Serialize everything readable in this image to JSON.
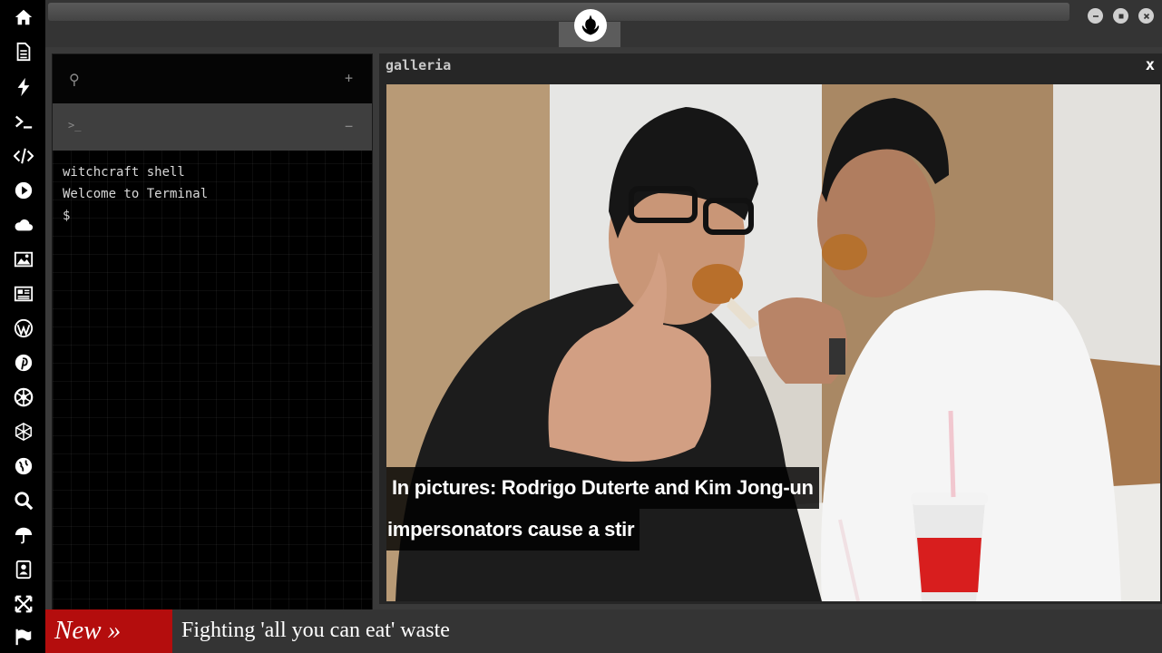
{
  "rail": {
    "icons": [
      "home-icon",
      "document-icon",
      "bolt-icon",
      "terminal-icon",
      "code-icon",
      "play-icon",
      "cloud-icon",
      "image-icon",
      "newspaper-icon",
      "wordpress-icon",
      "pinterest-icon",
      "rebel-badge-icon",
      "hexagon-network-icon",
      "globe-icon",
      "search-icon",
      "umbrella-icon",
      "contacts-icon",
      "expand-icon",
      "flag-icon"
    ]
  },
  "terminal": {
    "search_glyph": "⚲",
    "add_glyph": "+",
    "tab_prompt_glyph": ">_",
    "tab_close_glyph": "−",
    "lines": [
      "witchcraft shell",
      "Welcome to Terminal",
      "$"
    ]
  },
  "galleria": {
    "title": "galleria",
    "close_label": "x",
    "caption_line1": " In pictures: Rodrigo Duterte and Kim Jong-un",
    "caption_line2": "impersonators cause a stir"
  },
  "ticker": {
    "badge": "New »",
    "headline": "Fighting 'all you can eat' waste"
  },
  "colors": {
    "accent_red": "#b40d0d",
    "rail_bg": "#000000",
    "panel_bg": "#343434"
  }
}
